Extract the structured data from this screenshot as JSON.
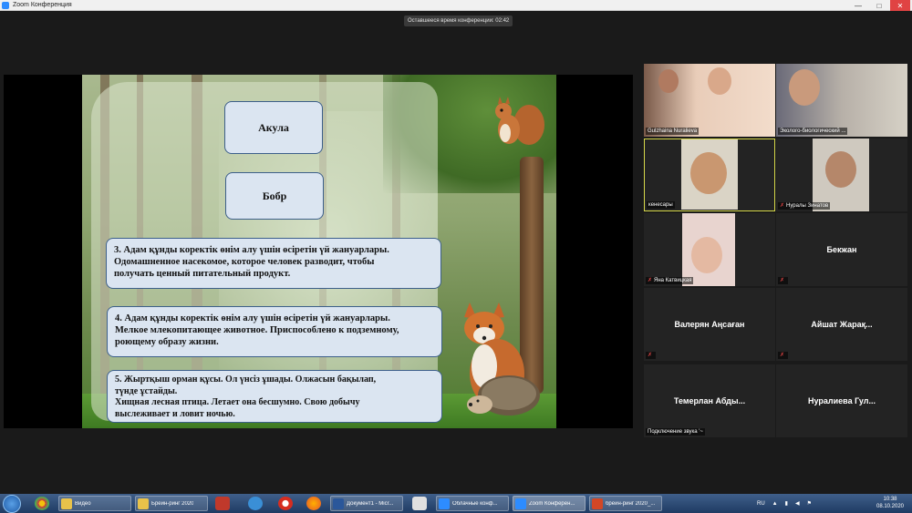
{
  "window": {
    "title": "Zoom Конференция",
    "minimize": "—",
    "maximize": "□",
    "close": "✕"
  },
  "timer": "Оставшееся время конференции: 02:42",
  "slide": {
    "word1": "Акула",
    "word2": "Бобр",
    "q1": [
      "3. Адам құнды коректік өнім алу үшін өсіретін үй жануарлары.",
      "Одомашненное насекомое, которое человек разводит, чтобы",
      "получать ценный питательный продукт."
    ],
    "q2": [
      "4. Адам құнды коректік өнім алу үшін өсіретін үй жануарлары.",
      "Мелкое млекопитающее животное. Приспособлено к подземному,",
      "роющему образу жизни."
    ],
    "q3": [
      "5. Жыртқыш орман құсы. Ол үнсіз ұшады. Олжасын бақылап,",
      "түнде ұстайды.",
      "Хищная лесная птица. Летает она бесшумно. Свою добычу",
      "выслеживает и ловит ночью."
    ]
  },
  "participants": [
    {
      "name": "Gulzhaina Nuralieva",
      "video": true
    },
    {
      "name": "Эколого-биологический ...",
      "video": true
    },
    {
      "name": "кенесары",
      "video": true,
      "active": true
    },
    {
      "name": "Нуралы Зинатов",
      "video": true,
      "muted": true
    },
    {
      "name": "Яна Катвицкая",
      "video": true,
      "muted": true
    },
    {
      "name": "Бекжан",
      "video": false,
      "muted": true
    },
    {
      "name": "Валерян Аңсаған",
      "video": false,
      "muted": true
    },
    {
      "name": "Айшат Жарақ...",
      "video": false,
      "muted": true
    },
    {
      "name": "Темерлан Абды...",
      "video": false,
      "status": "Подключение звука '~"
    },
    {
      "name": "Нуралиева Гул...",
      "video": false
    }
  ],
  "taskbar": {
    "tasks": [
      {
        "label": "Видео",
        "color": "#e8c24a"
      },
      {
        "label": "Брейн-ринг 2020",
        "color": "#e8c24a"
      },
      {
        "label": "Документ1 - Micr...",
        "color": "#2b579a"
      },
      {
        "label": "Облачные конф...",
        "color": "#2d8cff"
      },
      {
        "label": "Zoom Конферен...",
        "color": "#2d8cff"
      },
      {
        "label": "брейн-ринг 2020_...",
        "color": "#d24726"
      }
    ],
    "lang": "RU",
    "time": "10:38",
    "date": "08.10.2020"
  },
  "colors": {
    "accent": "#2d8cff",
    "active_border": "#d7d84a",
    "muted": "#e04343"
  }
}
